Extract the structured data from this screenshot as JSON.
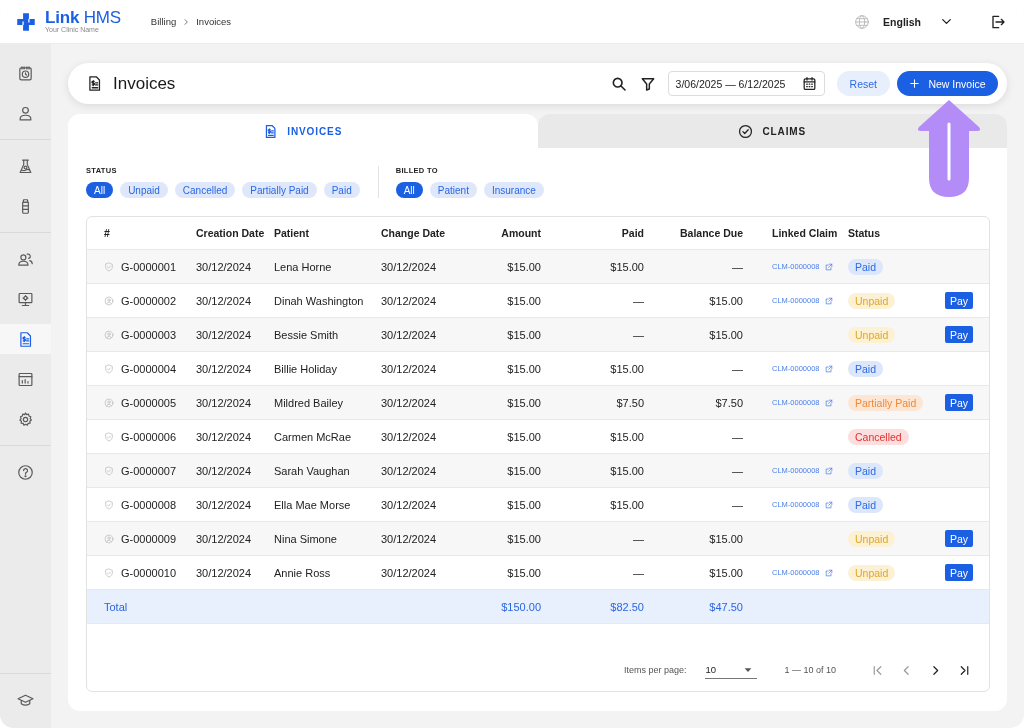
{
  "header": {
    "logo": {
      "name": "**Link** HMS",
      "subtitle": "Your Clinic Name"
    },
    "breadcrumb": [
      "Billing",
      "Invoices"
    ],
    "language": "English"
  },
  "sidebar": {
    "groups": [
      {
        "items": [
          {
            "kind": "calendar",
            "selected": false
          },
          {
            "kind": "user",
            "selected": false
          }
        ]
      },
      {
        "items": [
          {
            "kind": "flask",
            "selected": false
          },
          {
            "kind": "bottle",
            "selected": false
          }
        ]
      },
      {
        "items": [
          {
            "kind": "users",
            "selected": false
          },
          {
            "kind": "monitor",
            "selected": false
          },
          {
            "kind": "invoice",
            "selected": true
          },
          {
            "kind": "chart",
            "selected": false
          },
          {
            "kind": "gear",
            "selected": false
          }
        ]
      },
      {
        "items": [
          {
            "kind": "help",
            "selected": false
          }
        ]
      }
    ],
    "footer": {
      "items": [
        {
          "kind": "cap",
          "selected": false
        }
      ]
    }
  },
  "page": {
    "title": "Invoices",
    "date_range": "3/06/2025 — 6/12/2025",
    "reset_button": "Reset",
    "new_button": "New Invoice"
  },
  "tabs": [
    {
      "label": "INVOICES",
      "kind": "invoice",
      "selected": true
    },
    {
      "label": "CLAIMS",
      "kind": "check",
      "selected": false
    }
  ],
  "filters": [
    {
      "label": "STATUS",
      "options": [
        {
          "label": "All",
          "selected": true
        },
        {
          "label": "Unpaid",
          "selected": false
        },
        {
          "label": "Cancelled",
          "selected": false
        },
        {
          "label": "Partially Paid",
          "selected": false
        },
        {
          "label": "Paid",
          "selected": false
        }
      ]
    },
    {
      "label": "BILLED TO",
      "options": [
        {
          "label": "All",
          "selected": true
        },
        {
          "label": "Patient",
          "selected": false
        },
        {
          "label": "Insurance",
          "selected": false
        }
      ]
    }
  ],
  "table": {
    "columns": [
      "#",
      "Creation Date",
      "Patient",
      "Change Date",
      "Amount",
      "Paid",
      "Balance Due",
      "Linked Claim",
      "Status"
    ],
    "rows": [
      {
        "kind": "shield",
        "id": "G-0000001",
        "created": "30/12/2024",
        "patient": "Lena Horne",
        "changed": "30/12/2024",
        "amount": "$15.00",
        "paid": "$15.00",
        "balance": "—",
        "linked_claim": "CLM-0000008",
        "status": {
          "label": "Paid",
          "kind": "paid"
        }
      },
      {
        "kind": "person",
        "id": "G-0000002",
        "created": "30/12/2024",
        "patient": "Dinah Washington",
        "changed": "30/12/2024",
        "amount": "$15.00",
        "paid": "—",
        "balance": "$15.00",
        "linked_claim": "CLM-0000008",
        "status": {
          "label": "Unpaid",
          "kind": "unpaid"
        },
        "action": "Pay"
      },
      {
        "kind": "person",
        "id": "G-0000003",
        "created": "30/12/2024",
        "patient": "Bessie Smith",
        "changed": "30/12/2024",
        "amount": "$15.00",
        "paid": "—",
        "balance": "$15.00",
        "status": {
          "label": "Unpaid",
          "kind": "unpaid"
        },
        "action": "Pay"
      },
      {
        "kind": "shield",
        "id": "G-0000004",
        "created": "30/12/2024",
        "patient": "Billie Holiday",
        "changed": "30/12/2024",
        "amount": "$15.00",
        "paid": "$15.00",
        "balance": "—",
        "linked_claim": "CLM-0000008",
        "status": {
          "label": "Paid",
          "kind": "paid"
        }
      },
      {
        "kind": "person",
        "id": "G-0000005",
        "created": "30/12/2024",
        "patient": "Mildred Bailey",
        "changed": "30/12/2024",
        "amount": "$15.00",
        "paid": "$7.50",
        "balance": "$7.50",
        "linked_claim": "CLM-0000008",
        "status": {
          "label": "Partially Paid",
          "kind": "partial"
        },
        "action": "Pay"
      },
      {
        "kind": "shield",
        "id": "G-0000006",
        "created": "30/12/2024",
        "patient": "Carmen McRae",
        "changed": "30/12/2024",
        "amount": "$15.00",
        "paid": "$15.00",
        "balance": "—",
        "status": {
          "label": "Cancelled",
          "kind": "cancelled"
        }
      },
      {
        "kind": "shield",
        "id": "G-0000007",
        "created": "30/12/2024",
        "patient": "Sarah Vaughan",
        "changed": "30/12/2024",
        "amount": "$15.00",
        "paid": "$15.00",
        "balance": "—",
        "linked_claim": "CLM-0000008",
        "status": {
          "label": "Paid",
          "kind": "paid"
        }
      },
      {
        "kind": "shield",
        "id": "G-0000008",
        "created": "30/12/2024",
        "patient": "Ella Mae Morse",
        "changed": "30/12/2024",
        "amount": "$15.00",
        "paid": "$15.00",
        "balance": "—",
        "linked_claim": "CLM-0000008",
        "status": {
          "label": "Paid",
          "kind": "paid"
        }
      },
      {
        "kind": "person",
        "id": "G-0000009",
        "created": "30/12/2024",
        "patient": "Nina Simone",
        "changed": "30/12/2024",
        "amount": "$15.00",
        "paid": "—",
        "balance": "$15.00",
        "status": {
          "label": "Unpaid",
          "kind": "unpaid"
        },
        "action": "Pay"
      },
      {
        "kind": "shield",
        "id": "G-0000010",
        "created": "30/12/2024",
        "patient": "Annie Ross",
        "changed": "30/12/2024",
        "amount": "$15.00",
        "paid": "—",
        "balance": "$15.00",
        "linked_claim": "CLM-0000008",
        "status": {
          "label": "Unpaid",
          "kind": "unpaid"
        },
        "action": "Pay"
      }
    ],
    "totals": {
      "label": "Total",
      "amount": "$150.00",
      "paid": "$82.50",
      "balance": "$47.50"
    }
  },
  "pagination": {
    "items_per_page_label": "Items per page:",
    "page_size": "10",
    "range": "1 — 10 of 10",
    "buttons": [
      {
        "kind": "first",
        "disabled": true
      },
      {
        "kind": "prev",
        "disabled": true
      },
      {
        "kind": "next",
        "disabled": false
      },
      {
        "kind": "last",
        "disabled": false
      }
    ]
  },
  "annotations": [
    {
      "kind": "arrow"
    }
  ]
}
